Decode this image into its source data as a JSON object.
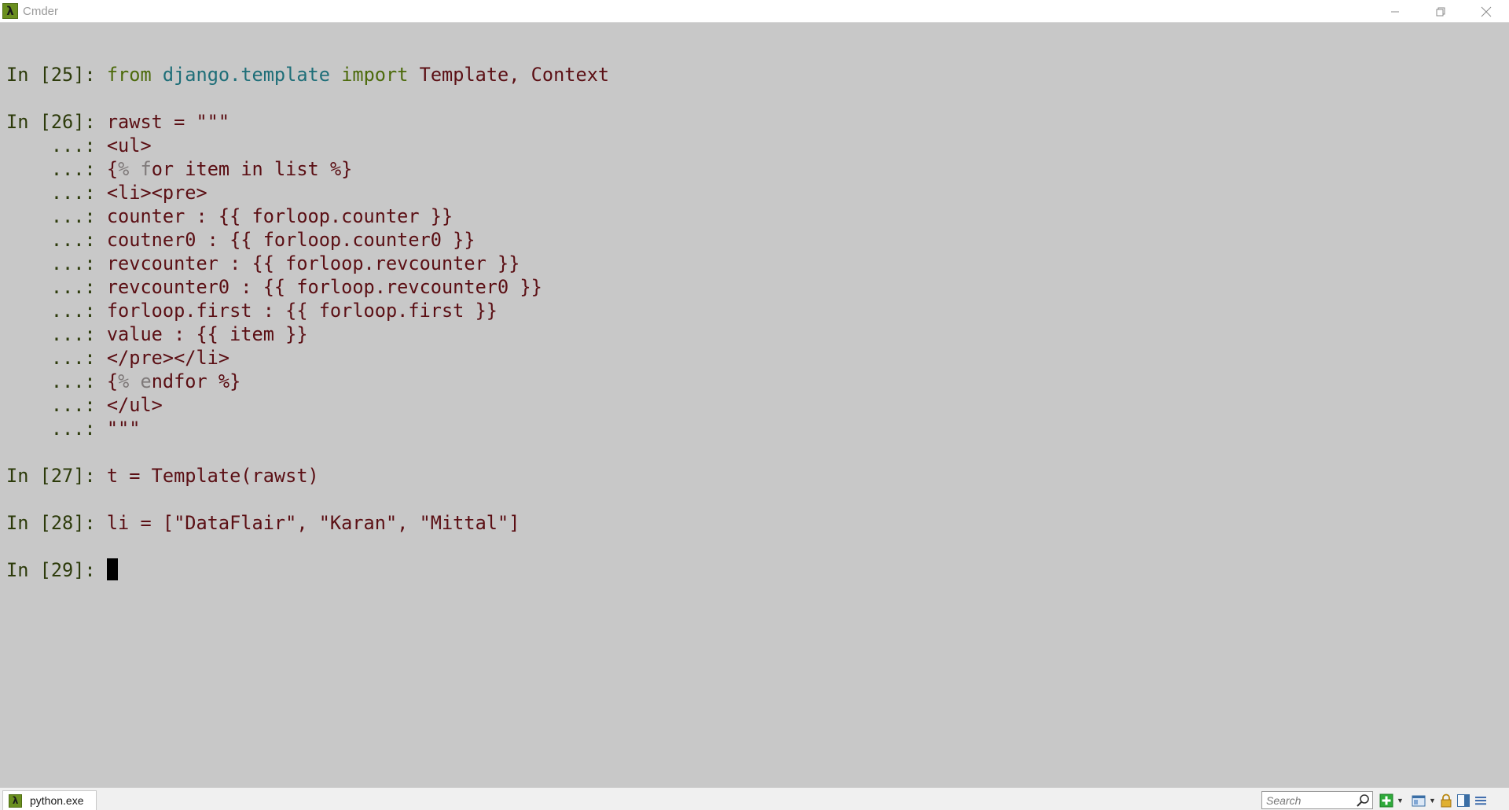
{
  "window": {
    "title": "Cmder",
    "app_icon_glyph": "λ",
    "controls": {
      "minimize_glyph": "—",
      "restore_glyph": "❐",
      "close_glyph": "✕"
    }
  },
  "console": {
    "l1": {
      "prompt": "In [25]: ",
      "kw1": "from",
      "sp1": " ",
      "mod": "django.template",
      "sp2": " ",
      "kw2": "import",
      "rest": " Template, Context"
    },
    "l2": {
      "prompt": "In [26]: ",
      "text": "rawst = \"\"\""
    },
    "l3": {
      "prompt": "    ...: ",
      "text": "<ul>"
    },
    "l4": {
      "prompt": "    ...: ",
      "a": "{",
      "b": "% f",
      "c": "or item in list %}"
    },
    "l5": {
      "prompt": "    ...: ",
      "text": "<li><pre>"
    },
    "l6": {
      "prompt": "    ...: ",
      "text": "counter : {{ forloop.counter }}"
    },
    "l7": {
      "prompt": "    ...: ",
      "text": "coutner0 : {{ forloop.counter0 }}"
    },
    "l8": {
      "prompt": "    ...: ",
      "text": "revcounter : {{ forloop.revcounter }}"
    },
    "l9": {
      "prompt": "    ...: ",
      "text": "revcounter0 : {{ forloop.revcounter0 }}"
    },
    "l10": {
      "prompt": "    ...: ",
      "text": "forloop.first : {{ forloop.first }}"
    },
    "l11": {
      "prompt": "    ...: ",
      "text": "value : {{ item }}"
    },
    "l12": {
      "prompt": "    ...: ",
      "text": "</pre></li>"
    },
    "l13": {
      "prompt": "    ...: ",
      "a": "{",
      "b": "% e",
      "c": "ndfor %}"
    },
    "l14": {
      "prompt": "    ...: ",
      "text": "</ul>"
    },
    "l15": {
      "prompt": "    ...: ",
      "text": "\"\"\""
    },
    "l16": {
      "prompt": "In [27]: ",
      "text": "t = Template(rawst)"
    },
    "l17": {
      "prompt": "In [28]: ",
      "text": "li = [\"DataFlair\", \"Karan\", \"Mittal\"]"
    },
    "l18": {
      "prompt": "In [29]: ",
      "text": ""
    }
  },
  "statusbar": {
    "tab_label": "python.exe",
    "tab_icon_glyph": "λ",
    "search_placeholder": "Search",
    "dropdown_glyph": "▼"
  },
  "colors": {
    "background": "#c8c8c8",
    "text": "#5b0f14",
    "prompt": "#2d3b0b",
    "keyword": "#4c6a0b",
    "module": "#1e6e78",
    "brand": "#6a8f1e"
  }
}
